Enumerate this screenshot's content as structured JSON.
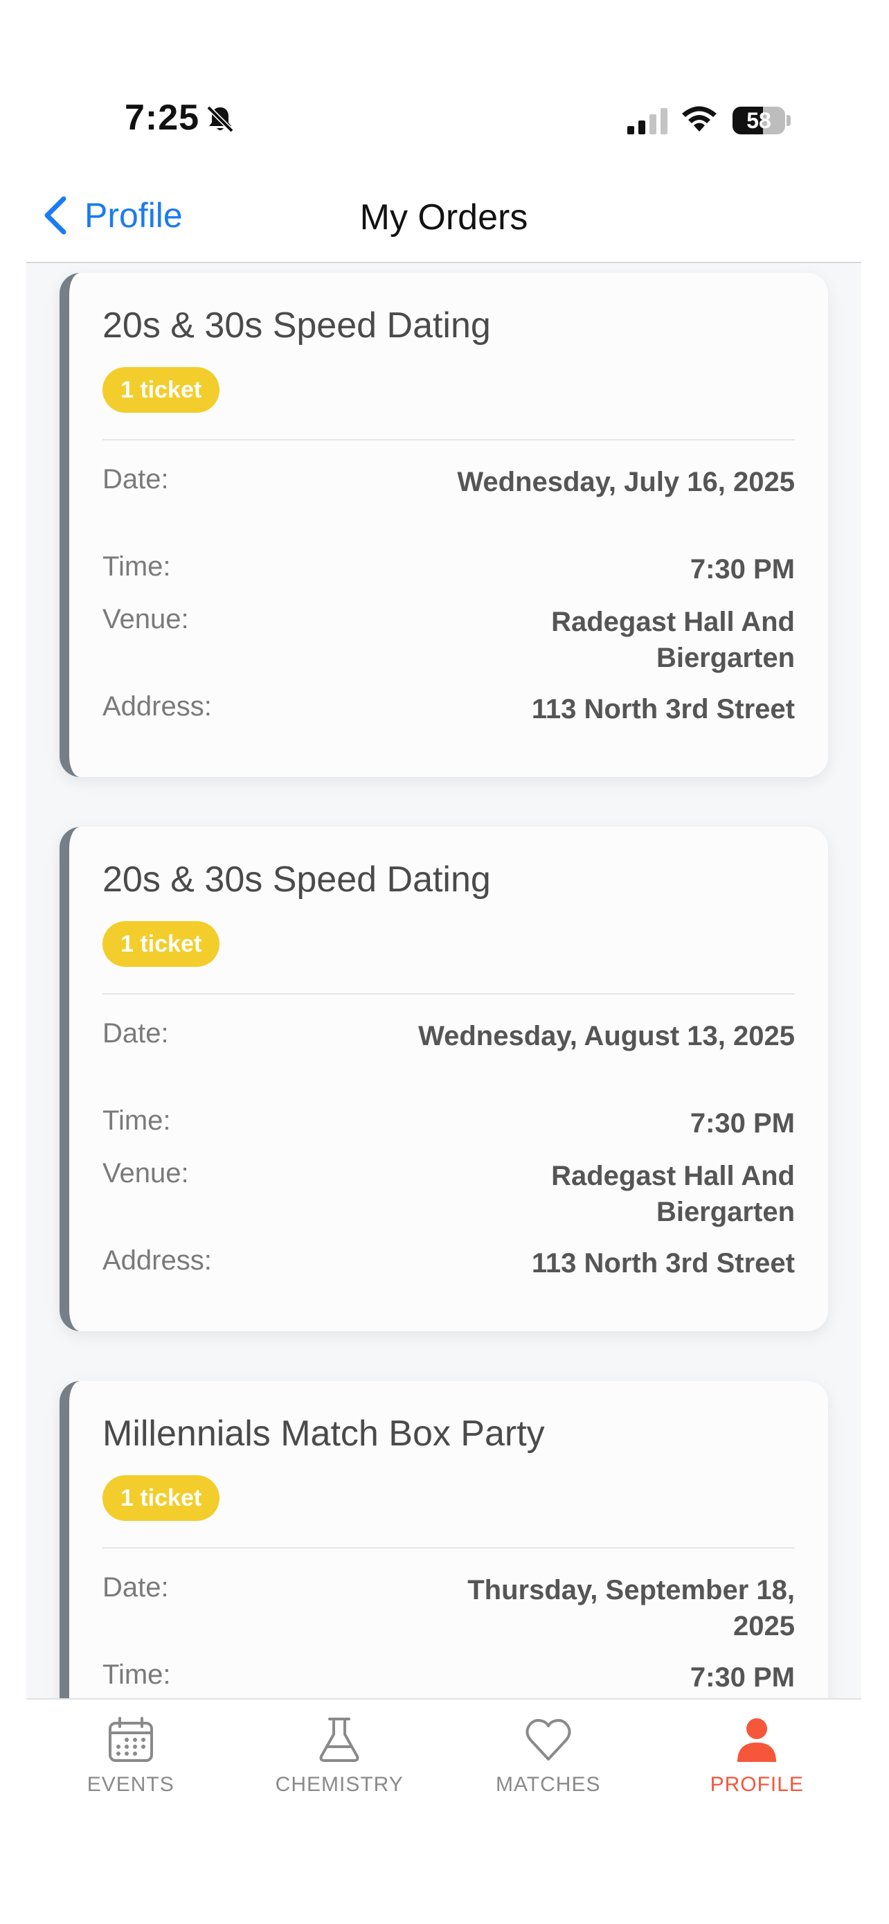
{
  "status_bar": {
    "time": "7:25",
    "battery": "58",
    "battery_level": 0.58
  },
  "nav": {
    "back_label": "Profile",
    "title": "My Orders"
  },
  "labels": {
    "date": "Date:",
    "time": "Time:",
    "venue": "Venue:",
    "address": "Address:"
  },
  "orders": [
    {
      "title": "20s & 30s Speed Dating",
      "tickets": "1 ticket",
      "date": "Wednesday, July 16, 2025",
      "time": "7:30 PM",
      "venue": "Radegast Hall And Biergarten",
      "address": "113 North 3rd Street"
    },
    {
      "title": "20s & 30s Speed Dating",
      "tickets": "1 ticket",
      "date": "Wednesday, August 13, 2025",
      "time": "7:30 PM",
      "venue": "Radegast Hall And Biergarten",
      "address": "113 North 3rd Street"
    },
    {
      "title": "Millennials Match Box Party",
      "tickets": "1 ticket",
      "date": "Thursday, September 18, 2025",
      "time": "7:30 PM",
      "venue": "",
      "address": ""
    }
  ],
  "tabs": [
    {
      "label": "EVENTS",
      "icon": "calendar-icon",
      "active": false
    },
    {
      "label": "CHEMISTRY",
      "icon": "flask-icon",
      "active": false
    },
    {
      "label": "MATCHES",
      "icon": "heart-icon",
      "active": false
    },
    {
      "label": "PROFILE",
      "icon": "person-icon",
      "active": true
    }
  ],
  "colors": {
    "accent_blue": "#1a7cf0",
    "active_tab": "#f6563a",
    "badge": "#f3cd2b",
    "card_border": "#757f88"
  }
}
